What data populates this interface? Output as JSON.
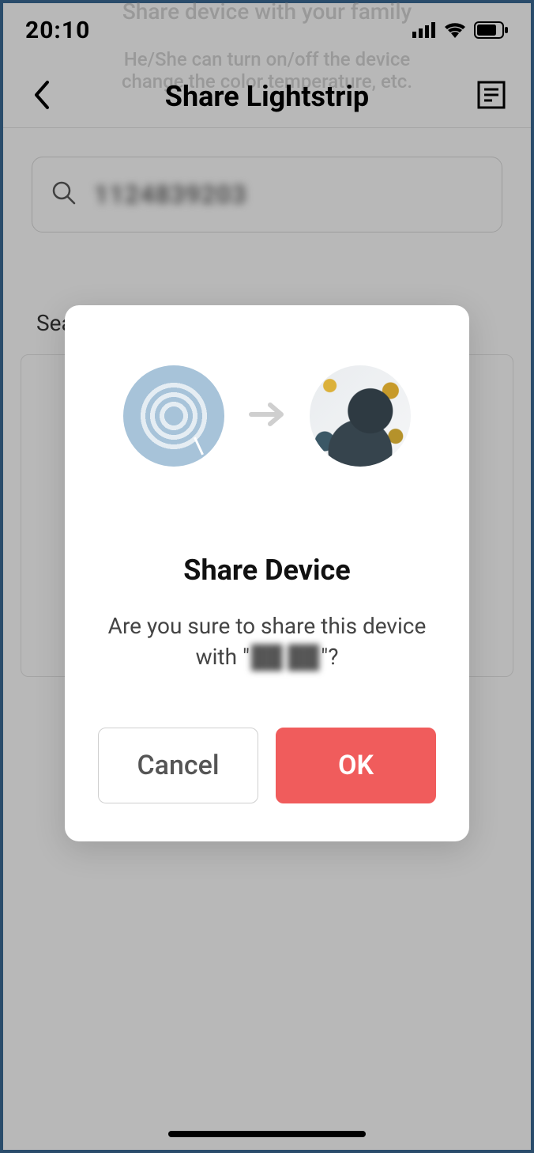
{
  "statusbar": {
    "time": "20:10"
  },
  "hint": {
    "line1": "Share device with your family",
    "line2": "He/She can turn on/off the device",
    "line3": "change the color temperature, etc."
  },
  "nav": {
    "title": "Share Lightstrip"
  },
  "search": {
    "value": "1124839203"
  },
  "results": {
    "label": "Search Result"
  },
  "modal": {
    "title": "Share Device",
    "message_prefix": "Are you sure to share this device with \"",
    "message_name": "██ ██",
    "message_suffix": "\"?",
    "cancel": "Cancel",
    "ok": "OK"
  }
}
